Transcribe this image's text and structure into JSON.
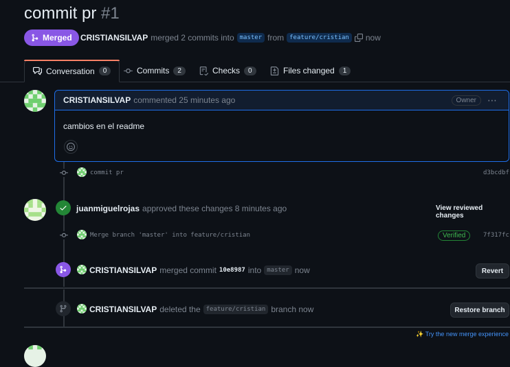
{
  "header": {
    "title": "commit pr",
    "number": "#1",
    "status_badge": "Merged",
    "merger": "CRISTIANSILVAP",
    "merge_text": "merged 2 commits into",
    "base_branch": "master",
    "from_text": "from",
    "head_branch": "feature/cristian",
    "time": "now"
  },
  "tabs": [
    {
      "label": "Conversation",
      "count": "0"
    },
    {
      "label": "Commits",
      "count": "2"
    },
    {
      "label": "Checks",
      "count": "0"
    },
    {
      "label": "Files changed",
      "count": "1"
    }
  ],
  "comment": {
    "author": "CRISTIANSILVAP",
    "action": "commented 25 minutes ago",
    "role": "Owner",
    "body": "cambios en el readme"
  },
  "commits": [
    {
      "message": "commit pr",
      "sha": "d3bcdbf"
    },
    {
      "message": "Merge branch 'master' into feature/cristian",
      "sha": "7f317fc",
      "verified": "Verified"
    }
  ],
  "review": {
    "author": "juanmiguelrojas",
    "action": "approved these changes 8 minutes ago",
    "button": "View reviewed changes"
  },
  "merge_event": {
    "author": "CRISTIANSILVAP",
    "text1": "merged commit",
    "commit": "10e8987",
    "text2": "into",
    "branch": "master",
    "time": "now",
    "button": "Revert"
  },
  "delete_event": {
    "author": "CRISTIANSILVAP",
    "text1": "deleted the",
    "branch": "feature/cristian",
    "text2": "branch now",
    "button": "Restore branch"
  },
  "footer": {
    "try_new": "Try the new merge experience"
  },
  "colors": {
    "background": "#0d1117",
    "merged_purple": "#8957e5",
    "approved_green": "#238636",
    "link_blue": "#4493f8",
    "border": "#30363d"
  }
}
